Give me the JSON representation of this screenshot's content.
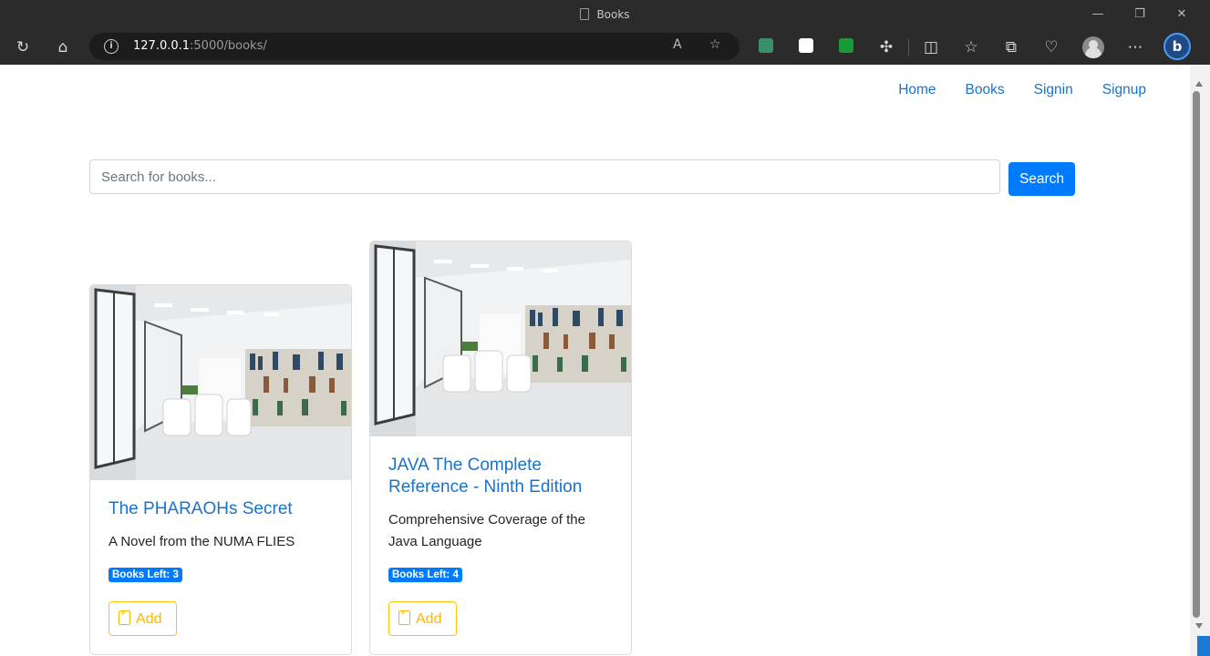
{
  "browser": {
    "window_title": "Books",
    "url_host": "127.0.0.1",
    "url_rest": ":5000/books/"
  },
  "nav": {
    "items": [
      "Home",
      "Books",
      "Signin",
      "Signup"
    ]
  },
  "search": {
    "placeholder": "Search for books...",
    "button_label": "Search"
  },
  "books": [
    {
      "title": "The PHARAOHs Secret",
      "description": "A Novel from the NUMA FLIES",
      "badge": "Books Left: 3",
      "add_label": "Add"
    },
    {
      "title": "JAVA The Complete Reference - Ninth Edition",
      "description": "Comprehensive Coverage of the Java Language",
      "badge": "Books Left: 4",
      "add_label": "Add"
    }
  ]
}
